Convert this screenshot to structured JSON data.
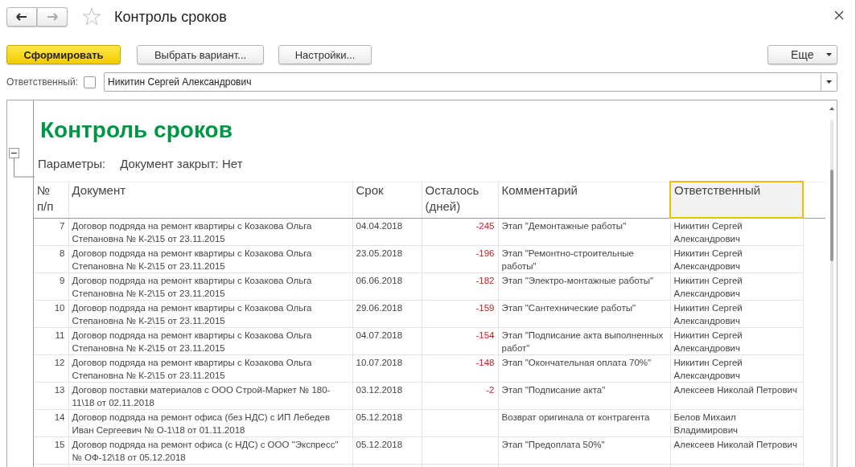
{
  "window": {
    "title": "Контроль сроков"
  },
  "toolbar": {
    "buttons": [
      {
        "label": "Сформировать",
        "kind": "primary"
      },
      {
        "label": "Выбрать вариант...",
        "kind": "normal"
      },
      {
        "label": "Настройки...",
        "kind": "normal"
      }
    ],
    "more_button": "Еще"
  },
  "filter": {
    "label": "Ответственный:",
    "checked": false,
    "value": "Никитин Сергей Александрович"
  },
  "report": {
    "title": "Контроль сроков",
    "parameters_label": "Параметры:",
    "parameters_value": "Документ закрыт: Нет",
    "expanded": true,
    "table": {
      "columns": [
        {
          "label": "№ п/п",
          "selected": false
        },
        {
          "label": "Документ",
          "selected": false
        },
        {
          "label": "Срок",
          "selected": false
        },
        {
          "label": "Осталось (дней)",
          "selected": false
        },
        {
          "label": "Комментарий",
          "selected": false
        },
        {
          "label": "Ответственный",
          "selected": true
        }
      ],
      "rows": [
        {
          "number": "7",
          "document": "Договор подряда на ремонт квартиры с Козакова Ольга Степановна № К-2\\15 от 23.11.2015",
          "deadline": "04.04.2018",
          "remaining": "-245",
          "comment": "Этап \"Демонтажные работы\"",
          "responsible": "Никитин Сергей Александрович"
        },
        {
          "number": "8",
          "document": "Договор подряда на ремонт квартиры с Козакова Ольга Степановна № К-2\\15 от 23.11.2015",
          "deadline": "23.05.2018",
          "remaining": "-196",
          "comment": "Этап \"Ремонтно-строительные работы\"",
          "responsible": "Никитин Сергей Александрович"
        },
        {
          "number": "9",
          "document": "Договор подряда на ремонт квартиры с Козакова Ольга Степановна № К-2\\15 от 23.11.2015",
          "deadline": "06.06.2018",
          "remaining": "-182",
          "comment": "Этап \"Электро-монтажные работы\"",
          "responsible": "Никитин Сергей Александрович"
        },
        {
          "number": "10",
          "document": "Договор подряда на ремонт квартиры с Козакова Ольга Степановна № К-2\\15 от 23.11.2015",
          "deadline": "29.06.2018",
          "remaining": "-159",
          "comment": "Этап \"Сантехнические работы\"",
          "responsible": "Никитин Сергей Александрович"
        },
        {
          "number": "11",
          "document": "Договор подряда на ремонт квартиры с Козакова Ольга Степановна № К-2\\15 от 23.11.2015",
          "deadline": "04.07.2018",
          "remaining": "-154",
          "comment": "Этап \"Подписание акта выполненных работ\"",
          "responsible": "Никитин Сергей Александрович"
        },
        {
          "number": "12",
          "document": "Договор подряда на ремонт квартиры с Козакова Ольга Степановна № К-2\\15 от 23.11.2015",
          "deadline": "10.07.2018",
          "remaining": "-148",
          "comment": "Этап \"Окончательная оплата 70%\"",
          "responsible": "Никитин Сергей Александрович"
        },
        {
          "number": "13",
          "document": "Договор поставки материалов с ООО Строй-Маркет № 180-11\\18 от 02.11.2018",
          "deadline": "03.12.2018",
          "remaining": "-2",
          "comment": "Этап \"Подписание акта\"",
          "responsible": "Алексеев Николай Петрович"
        },
        {
          "number": "14",
          "document": "Договор подряда на ремонт офиса (без НДС) с ИП Лебедев Иван Сергеевич № О-1\\18 от 01.11.2018",
          "deadline": "05.12.2018",
          "comment": "Возврат оригинала от контрагента",
          "responsible": "Белов Михаил Владимирович"
        },
        {
          "number": "15",
          "document": "Договор подряда на ремонт офиса (с НДС) с ООО \"Экспресс\" № ОФ-12\\18 от 05.12.2018",
          "deadline": "05.12.2018",
          "comment": "Этап \"Предоплата 50%\"",
          "responsible": "Алексеев Николай Петрович"
        }
      ]
    }
  }
}
